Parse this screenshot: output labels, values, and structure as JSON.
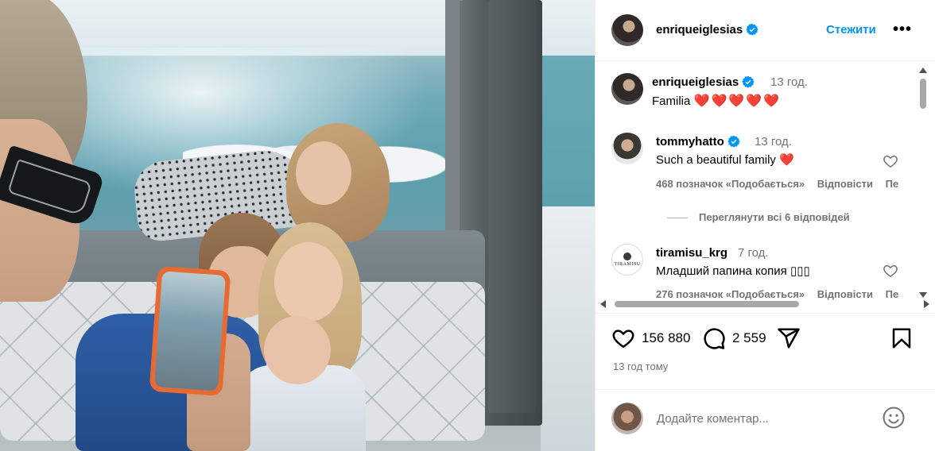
{
  "post": {
    "author": "enriqueiglesias",
    "follow_label": "Стежити",
    "more_label": "•••",
    "caption": {
      "author": "enriqueiglesias",
      "time": "13 год.",
      "text": "Familia",
      "hearts": "❤️❤️❤️❤️❤️"
    },
    "comments": [
      {
        "author": "tommyhatto",
        "verified": true,
        "time": "13 год.",
        "text": "Such a beautiful family",
        "emoji": "❤️",
        "likes": "468 позначок «Подобається»",
        "reply": "Відповісти",
        "extra": "Пе"
      },
      {
        "author": "tiramisu_krg",
        "verified": false,
        "time": "7 год.",
        "text": "Младший папина копия ",
        "emoji": "▯▯▯",
        "likes": "276 позначок «Подобається»",
        "reply": "Відповісти",
        "extra": "Пе",
        "avatar_text": "TIRAMISU"
      }
    ],
    "view_replies": "Переглянути всі 6 відповідей",
    "like_count": "156 880",
    "comment_count": "2 559",
    "time_ago": "13 год тому",
    "comment_placeholder": "Додайте коментар..."
  },
  "colors": {
    "accent": "#0095f6",
    "verified": "#0095f6",
    "heart": "#ed1c24",
    "muted": "#737373"
  },
  "icons": {
    "like": "heart-icon",
    "comment": "comment-icon",
    "share": "send-icon",
    "save": "bookmark-icon",
    "emoji": "smiley-icon",
    "verified": "verified-badge-icon"
  }
}
